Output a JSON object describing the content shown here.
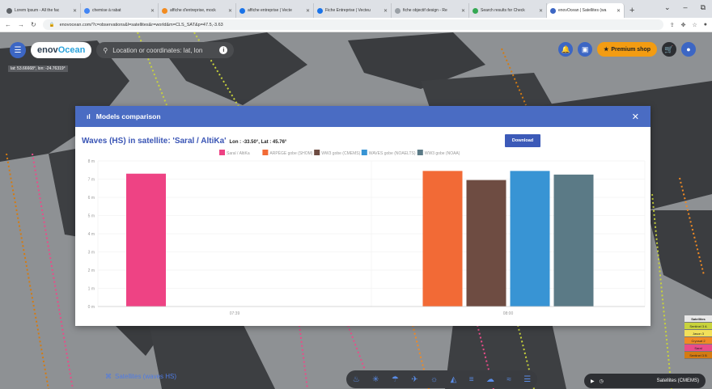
{
  "browser": {
    "tabs": [
      {
        "label": "Lorem Ipsum - All the fac",
        "color": "#5f6368"
      },
      {
        "label": "chemise à rabat",
        "color": "#4285f4"
      },
      {
        "label": "affiche d'entreprise, mock",
        "color": "#f28b20"
      },
      {
        "label": "affiche entreprise | Vecte",
        "color": "#1a73e8"
      },
      {
        "label": "Fiche Entreprise | Vecteu",
        "color": "#1a73e8"
      },
      {
        "label": "fiche objectif design - Re",
        "color": "#9aa0a6"
      },
      {
        "label": "Search results for Check",
        "color": "#34a853"
      },
      {
        "label": "enovOcean | Satellites (wa",
        "color": "#3c66c4"
      }
    ],
    "url": "enovocean.com/?c=observations&l=satellites&r=world&m=CLS_SAT&p=47.5,-3.63",
    "window_controls": [
      "⌄",
      "–",
      "⧉"
    ]
  },
  "app": {
    "logo_prefix": "enov",
    "logo_o": "O",
    "logo_suffix": "cean",
    "search_placeholder": "Location or coordinates: lat, lon",
    "coords": "lat: 53.66668°, lon: -24.76319°",
    "premium_label": "Premium shop",
    "bottom_left_label": "Satellites (waves HS)",
    "bottom_right_label": "Satellites (CMEMS)"
  },
  "legend": {
    "title": "Satellites",
    "items": [
      {
        "label": "Sentinel 3 A",
        "color": "#c8d23c"
      },
      {
        "label": "Jason 3",
        "color": "#f2e05a"
      },
      {
        "label": "Cryosat 2",
        "color": "#f08a24"
      },
      {
        "label": "Saral",
        "color": "#e94c89"
      },
      {
        "label": "Sentinel 3 B",
        "color": "#d47b12"
      }
    ]
  },
  "modal": {
    "header": "Models comparison",
    "close": "✕",
    "title": "Waves (HS) in satellite: 'Saral / AltiKa'",
    "lonlat": "Lon : -33.50°, Lat : 45.76°",
    "download": "Download"
  },
  "chart_data": {
    "type": "bar",
    "x_categories": [
      "07:39",
      "08:00"
    ],
    "ylim": [
      0,
      8
    ],
    "yticks": [
      "0 m",
      "1 m",
      "2 m",
      "3 m",
      "4 m",
      "5 m",
      "6 m",
      "7 m",
      "8 m"
    ],
    "grid": true,
    "legend_position": "top",
    "series": [
      {
        "name": "Saral / AltiKa",
        "color": "#ee4384",
        "values": [
          7.3,
          null
        ]
      },
      {
        "name": "ARPÈGE gobe (SHOM)",
        "color": "#f26a36",
        "values": [
          null,
          7.45
        ]
      },
      {
        "name": "WW3 gobe (CMEMS)",
        "color": "#6e4c42",
        "values": [
          null,
          6.95
        ]
      },
      {
        "name": "WAVES gobe (NOAELTS)",
        "color": "#3894d4",
        "values": [
          null,
          7.45
        ]
      },
      {
        "name": "WW3 gobe (NOAA)",
        "color": "#5b7a86",
        "values": [
          null,
          7.25
        ]
      }
    ]
  }
}
